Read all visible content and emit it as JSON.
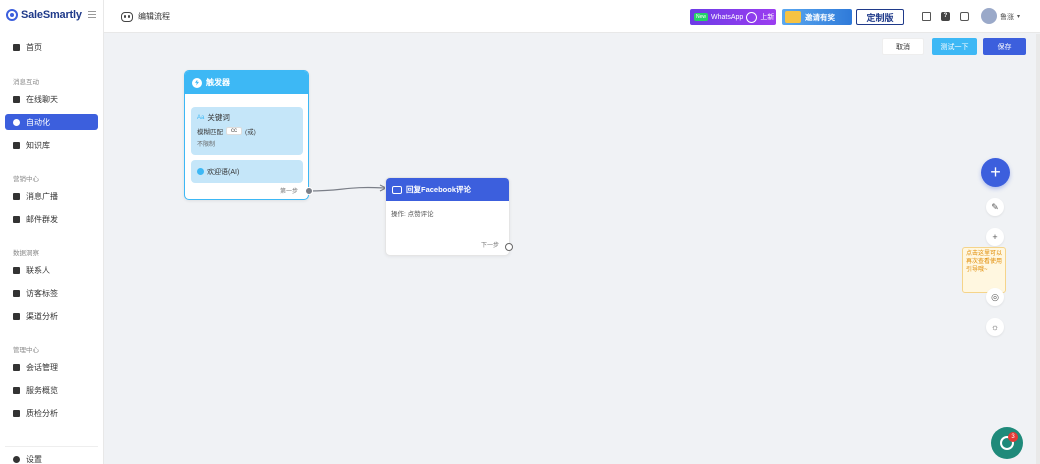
{
  "app": {
    "name": "SaleSmartly"
  },
  "sidebar": {
    "items": [
      {
        "label": "首页",
        "icon": "home-icon"
      },
      {
        "label": "在线聊天",
        "icon": "chat-icon"
      },
      {
        "label": "自动化",
        "icon": "robot-icon",
        "active": true
      },
      {
        "label": "知识库",
        "icon": "book-icon"
      },
      {
        "label": "消息广播",
        "icon": "broadcast-icon"
      },
      {
        "label": "邮件群发",
        "icon": "mail-icon"
      },
      {
        "label": "联系人",
        "icon": "contacts-icon"
      },
      {
        "label": "访客标签",
        "icon": "tag-icon"
      },
      {
        "label": "渠道分析",
        "icon": "bar-chart-icon"
      },
      {
        "label": "会话管理",
        "icon": "conversation-icon"
      },
      {
        "label": "服务概览",
        "icon": "grid-icon"
      },
      {
        "label": "质检分析",
        "icon": "report-icon"
      },
      {
        "label": "设置",
        "icon": "gear-icon"
      }
    ],
    "sections": [
      "消息互动",
      "营销中心",
      "数据洞察",
      "管理中心"
    ]
  },
  "header": {
    "title": "编辑流程",
    "whatsapp_new": "New",
    "whatsapp_label": "WhatsApp",
    "whatsapp_suffix": "上新",
    "invite_label": "邀请有奖",
    "custom_label": "定制版",
    "help_label": "?",
    "user_name": "鲁涨"
  },
  "actions": {
    "cancel": "取消",
    "test": "测试一下",
    "save": "保存"
  },
  "flow": {
    "trigger_node": {
      "title": "触发器",
      "keyword_title": "关键词",
      "keyword_prefix": "Aa",
      "match_mode": "模糊匹配",
      "keyword_tag": "cc",
      "keyword_suffix": "(或)",
      "limit_note": "不限制",
      "welcome_label": "欢迎语(AI)",
      "step_label": "第一步"
    },
    "reply_node": {
      "title": "回复Facebook评论",
      "action_text": "操作: 点赞评论",
      "step_label": "下一步"
    }
  },
  "tools": {
    "add": "+",
    "zoom_in": "+",
    "tip": "点击这里可以再次查看使用引导哦~"
  },
  "chat_widget": {
    "badge": "3"
  },
  "colors": {
    "primary": "#3c5fdd",
    "trigger": "#3db8f5",
    "accent": "#9b3df0"
  }
}
